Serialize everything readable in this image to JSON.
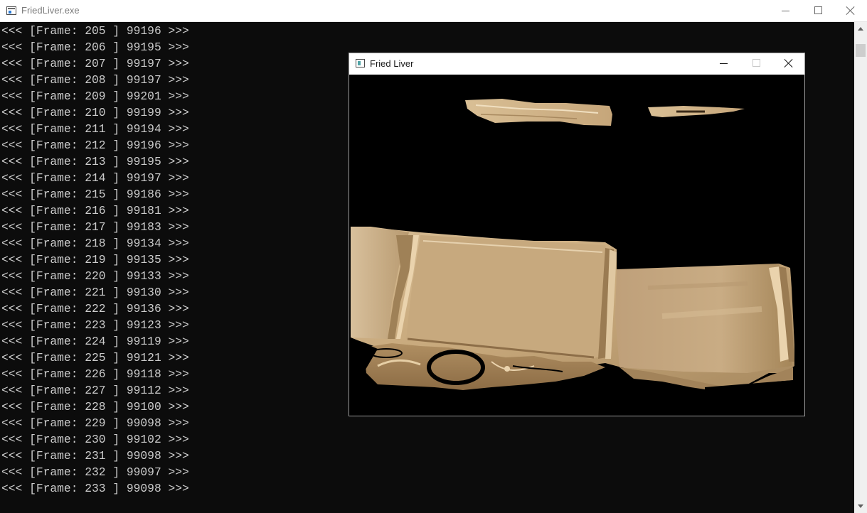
{
  "console": {
    "title": "FriedLiver.exe",
    "lines": [
      "<<< [Frame: 205 ] 99196 >>>",
      "<<< [Frame: 206 ] 99195 >>>",
      "<<< [Frame: 207 ] 99197 >>>",
      "<<< [Frame: 208 ] 99197 >>>",
      "<<< [Frame: 209 ] 99201 >>>",
      "<<< [Frame: 210 ] 99199 >>>",
      "<<< [Frame: 211 ] 99194 >>>",
      "<<< [Frame: 212 ] 99196 >>>",
      "<<< [Frame: 213 ] 99195 >>>",
      "<<< [Frame: 214 ] 99197 >>>",
      "<<< [Frame: 215 ] 99186 >>>",
      "<<< [Frame: 216 ] 99181 >>>",
      "<<< [Frame: 217 ] 99183 >>>",
      "<<< [Frame: 218 ] 99134 >>>",
      "<<< [Frame: 219 ] 99135 >>>",
      "<<< [Frame: 220 ] 99133 >>>",
      "<<< [Frame: 221 ] 99130 >>>",
      "<<< [Frame: 222 ] 99136 >>>",
      "<<< [Frame: 223 ] 99123 >>>",
      "<<< [Frame: 224 ] 99119 >>>",
      "<<< [Frame: 225 ] 99121 >>>",
      "<<< [Frame: 226 ] 99118 >>>",
      "<<< [Frame: 227 ] 99112 >>>",
      "<<< [Frame: 228 ] 99100 >>>",
      "<<< [Frame: 229 ] 99098 >>>",
      "<<< [Frame: 230 ] 99102 >>>",
      "<<< [Frame: 231 ] 99098 >>>",
      "<<< [Frame: 232 ] 99097 >>>",
      "<<< [Frame: 233 ] 99098 >>>"
    ],
    "icons": [
      "console-app-icon",
      "minimize-icon",
      "maximize-icon",
      "close-icon",
      "scroll-up-arrow-icon",
      "scroll-down-arrow-icon"
    ]
  },
  "render_window": {
    "title": "Fried Liver",
    "icons": [
      "app-icon",
      "minimize-icon",
      "maximize-icon",
      "close-icon"
    ]
  },
  "colors": {
    "console_background": "#0c0c0c",
    "console_text": "#cccccc",
    "surface_tan": "#c8a87c",
    "surface_highlight": "#e6cfa6",
    "surface_shadow": "#8a6a44"
  }
}
